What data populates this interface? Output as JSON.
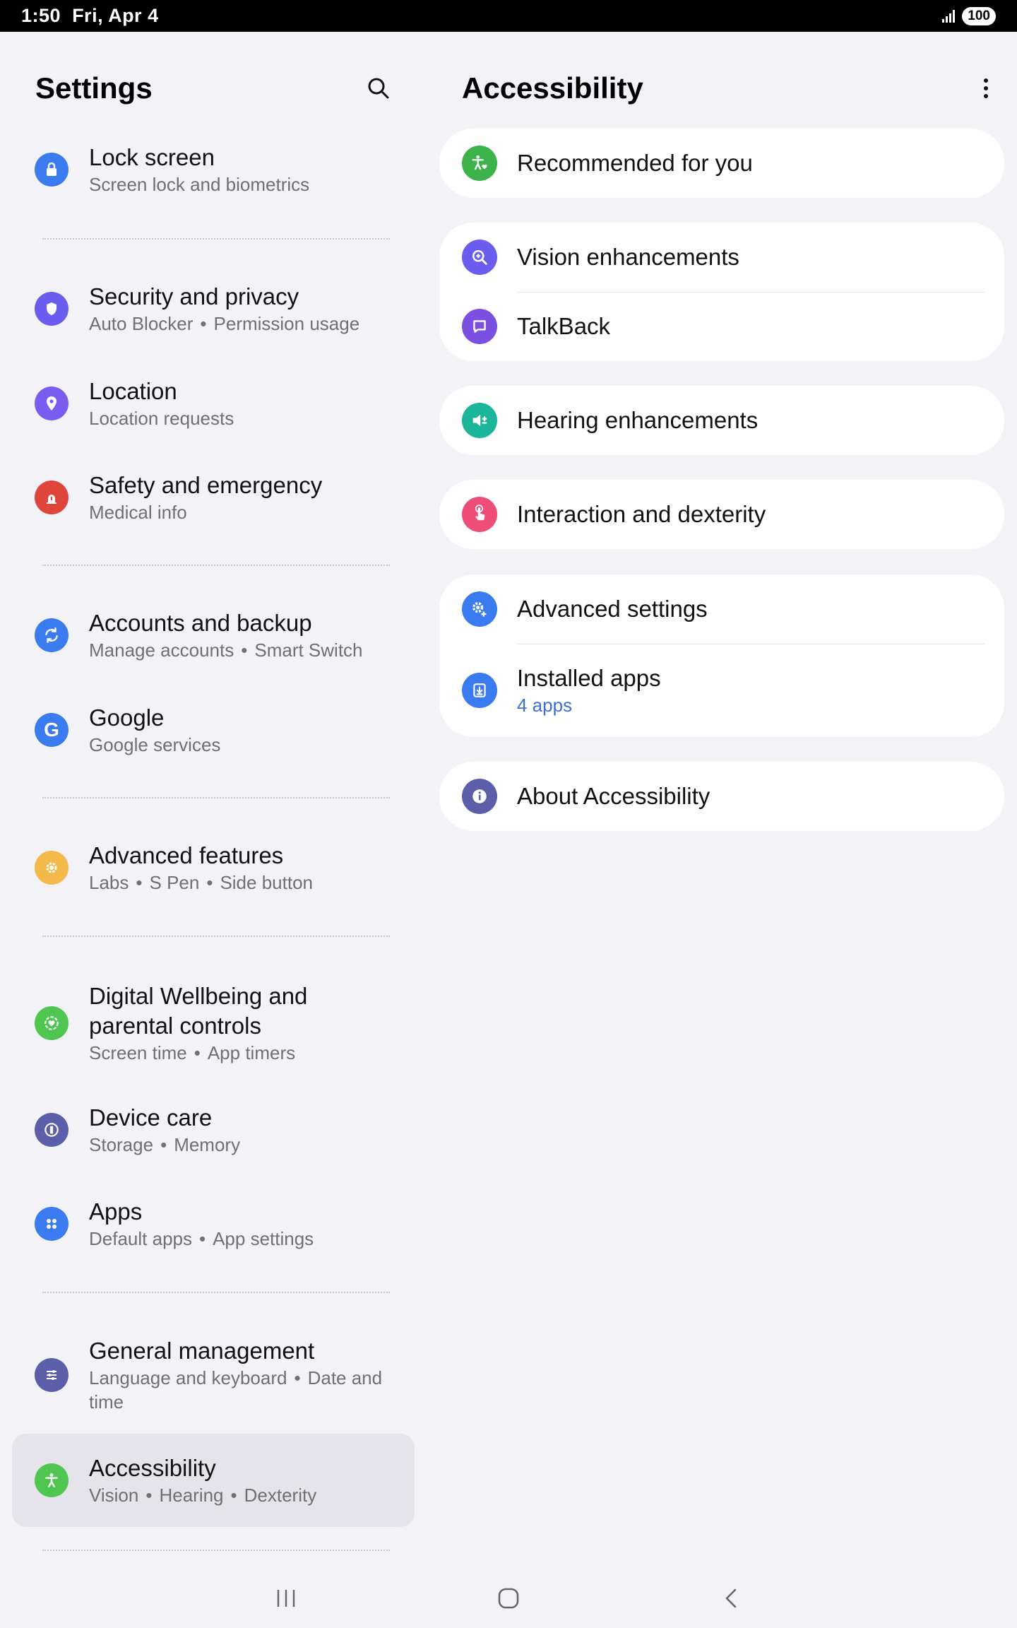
{
  "status": {
    "time": "1:50",
    "date": "Fri, Apr 4",
    "battery": "100"
  },
  "left": {
    "title": "Settings",
    "search_icon": "search-icon",
    "items": [
      {
        "title": "Lock screen",
        "subtitle": [
          "Screen lock and biometrics"
        ],
        "icon": "lock-icon",
        "color": "#3b7bf0"
      },
      {
        "title": "Security and privacy",
        "subtitle": [
          "Auto Blocker",
          "Permission usage"
        ],
        "icon": "shield-icon",
        "color": "#6b5cf0"
      },
      {
        "title": "Location",
        "subtitle": [
          "Location requests"
        ],
        "icon": "location-pin-icon",
        "color": "#7b5cf0"
      },
      {
        "title": "Safety and emergency",
        "subtitle": [
          "Medical info"
        ],
        "icon": "emergency-icon",
        "color": "#e0453b"
      },
      {
        "title": "Accounts and backup",
        "subtitle": [
          "Manage accounts",
          "Smart Switch"
        ],
        "icon": "sync-icon",
        "color": "#3b7bf0"
      },
      {
        "title": "Google",
        "subtitle": [
          "Google services"
        ],
        "icon": "google-icon",
        "color": "#3b7bf0"
      },
      {
        "title": "Advanced features",
        "subtitle": [
          "Labs",
          "S Pen",
          "Side button"
        ],
        "icon": "gear-plus-icon",
        "color": "#f5b84a"
      },
      {
        "title": "Digital Wellbeing and parental controls",
        "subtitle": [
          "Screen time",
          "App timers"
        ],
        "icon": "wellbeing-icon",
        "color": "#4fc64f"
      },
      {
        "title": "Device care",
        "subtitle": [
          "Storage",
          "Memory"
        ],
        "icon": "device-care-icon",
        "color": "#5b5ea8"
      },
      {
        "title": "Apps",
        "subtitle": [
          "Default apps",
          "App settings"
        ],
        "icon": "apps-grid-icon",
        "color": "#3b7bf0"
      },
      {
        "title": "General management",
        "subtitle": [
          "Language and keyboard",
          "Date and time"
        ],
        "icon": "sliders-icon",
        "color": "#5b5ea8"
      },
      {
        "title": "Accessibility",
        "subtitle": [
          "Vision",
          "Hearing",
          "Dexterity"
        ],
        "icon": "accessibility-icon",
        "color": "#4fc64f",
        "selected": true
      }
    ]
  },
  "right": {
    "title": "Accessibility",
    "more_icon": "more-vertical-icon",
    "items": {
      "recommended": {
        "title": "Recommended for you",
        "icon": "accessibility-heart-icon",
        "color": "#3bb34a"
      },
      "vision": {
        "title": "Vision enhancements",
        "icon": "magnifier-plus-icon",
        "color": "#6b5cf0"
      },
      "talkback": {
        "title": "TalkBack",
        "icon": "speech-bubble-icon",
        "color": "#7b4fe0"
      },
      "hearing": {
        "title": "Hearing enhancements",
        "icon": "speaker-icon",
        "color": "#1bb59a"
      },
      "interaction": {
        "title": "Interaction and dexterity",
        "icon": "touch-hand-icon",
        "color": "#ee4d79"
      },
      "advanced": {
        "title": "Advanced settings",
        "icon": "gear-plus-icon",
        "color": "#3b7bf0"
      },
      "installed": {
        "title": "Installed apps",
        "subtitle": "4 apps",
        "icon": "download-icon",
        "color": "#3b7bf0"
      },
      "about": {
        "title": "About Accessibility",
        "icon": "info-icon",
        "color": "#5b5ea8"
      }
    }
  },
  "nav": {
    "recents": "recents-icon",
    "home": "home-icon",
    "back": "back-icon"
  }
}
